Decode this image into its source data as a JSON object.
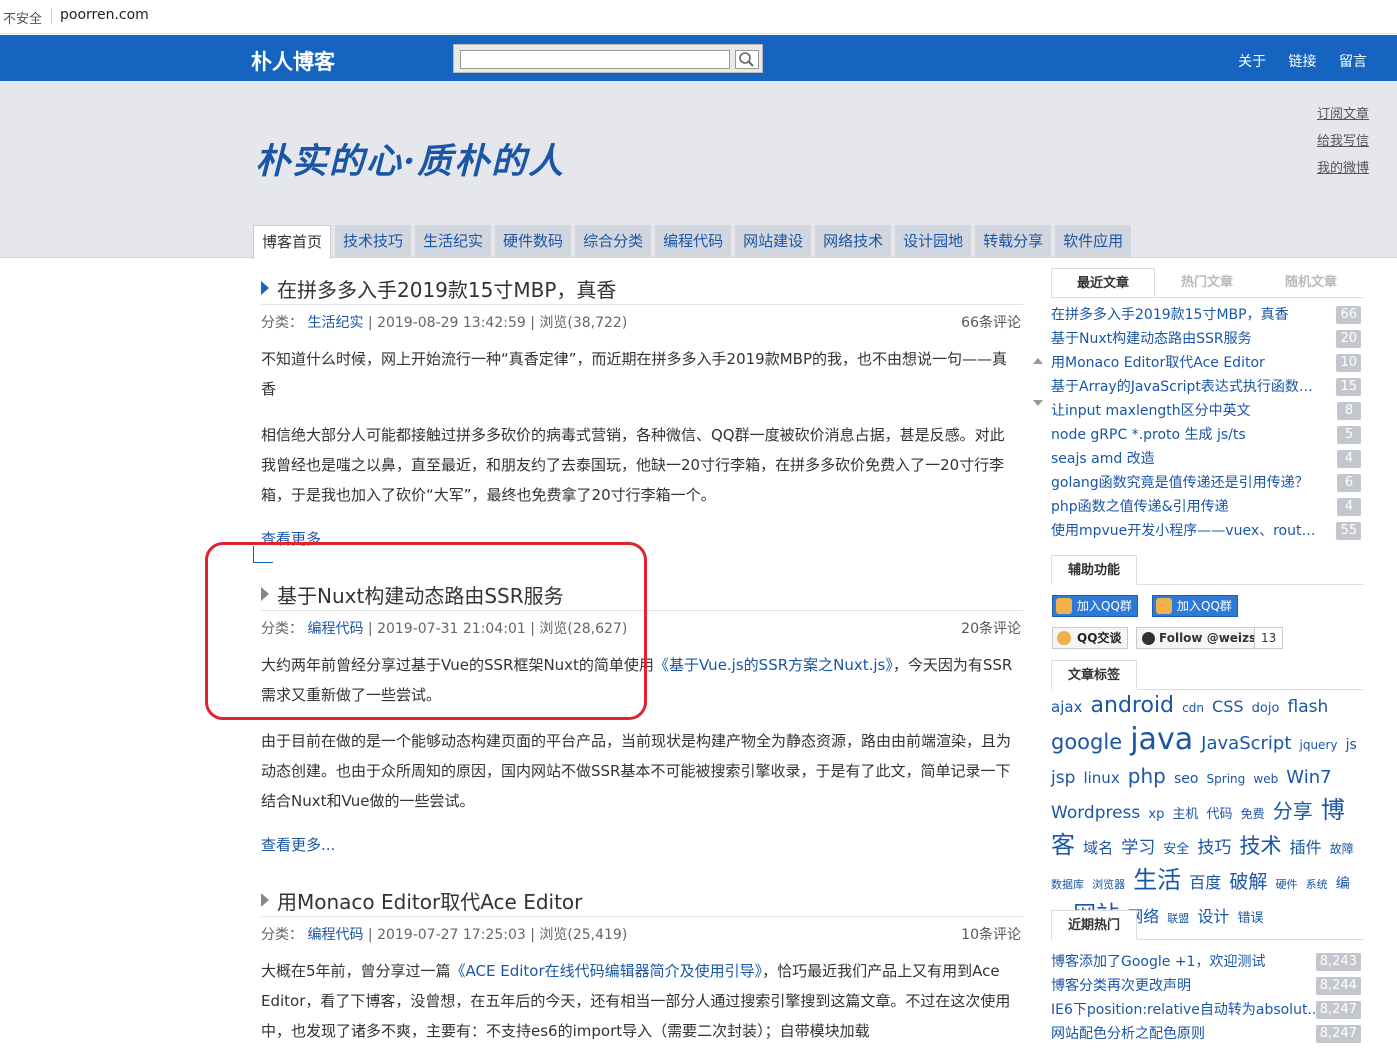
{
  "browser": {
    "insecure": "不安全",
    "url": "poorren.com"
  },
  "header": {
    "brand": "朴人博客",
    "search_placeholder": "",
    "nav": [
      "关于",
      "链接",
      "留言"
    ]
  },
  "banner": {
    "slogan": "朴实的心·质朴的人",
    "side_links": [
      "订阅文章",
      "给我写信",
      "我的微博"
    ],
    "categories": [
      "博客首页",
      "技术技巧",
      "生活纪实",
      "硬件数码",
      "综合分类",
      "编程代码",
      "网站建设",
      "网络技术",
      "设计园地",
      "转载分享",
      "软件应用"
    ]
  },
  "posts": [
    {
      "title": "在拼多多入手2019款15寸MBP，真香",
      "meta_prefix": "分类：",
      "category": "生活纪实",
      "meta_suffix": "| 2019-08-29 13:42:59 | 浏览(38,722)",
      "comments": "66条评论",
      "p1": "不知道什么时候，网上开始流行一种“真香定律”，而近期在拼多多入手2019款MBP的我，也不由想说一句——真香",
      "p2": "相信绝大部分人可能都接触过拼多多砍价的病毒式营销，各种微信、QQ群一度被砍价消息占据，甚是反感。对此我曾经也是嗤之以鼻，直至最近，和朋友约了去泰国玩，他缺一20寸行李箱，在拼多多砍价免费入了一20寸行李箱，于是我也加入了砍价“大军”，最终也免费拿了20寸行李箱一个。",
      "more": "查看更多..."
    },
    {
      "title": "基于Nuxt构建动态路由SSR服务",
      "meta_prefix": "分类：",
      "category": "编程代码",
      "meta_suffix": "| 2019-07-31 21:04:01 | 浏览(28,627)",
      "comments": "20条评论",
      "p1_a": "大约两年前曾经分享过基于Vue的SSR框架Nuxt的简单使用",
      "p1_link": "《基于Vue.js的SSR方案之Nuxt.js》",
      "p1_b": "，今天因为有SSR需求又重新做了一些尝试。",
      "p2": "由于目前在做的是一个能够动态构建页面的平台产品，当前现状是构建产物全为静态资源，路由由前端渲染，且为动态创建。也由于众所周知的原因，国内网站不做SSR基本不可能被搜索引擎收录，于是有了此文，简单记录一下结合Nuxt和Vue做的一些尝试。",
      "more": "查看更多..."
    },
    {
      "title": "用Monaco Editor取代Ace Editor",
      "meta_prefix": "分类：",
      "category": "编程代码",
      "meta_suffix": "| 2019-07-27 17:25:03 | 浏览(25,419)",
      "comments": "10条评论",
      "p1_a": "大概在5年前，曾分享过一篇",
      "p1_link": "《ACE Editor在线代码编辑器简介及使用引导》",
      "p1_b": "，恰巧最近我们产品上又有用到Ace Editor，看了下博客，没曾想，在五年后的今天，还有相当一部分人通过搜索引擎搜到这篇文章。不过在这次使用中，也发现了诸多不爽，主要有：不支持es6的import导入（需要二次封装）；自带模块加载"
    }
  ],
  "sidebar": {
    "tabs": [
      "最近文章",
      "热门文章",
      "随机文章"
    ],
    "recent": [
      {
        "title": "在拼多多入手2019款15寸MBP，真香",
        "count": "66"
      },
      {
        "title": "基于Nuxt构建动态路由SSR服务",
        "count": "20"
      },
      {
        "title": "用Monaco Editor取代Ace Editor",
        "count": "10"
      },
      {
        "title": "基于Array的JavaScript表达式执行函数实现",
        "count": "15"
      },
      {
        "title": "让input maxlength区分中英文",
        "count": "8"
      },
      {
        "title": "node gRPC *.proto 生成 js/ts",
        "count": "5"
      },
      {
        "title": "seajs amd 改造",
        "count": "4"
      },
      {
        "title": "golang函数究竟是值传递还是引用传递？",
        "count": "6"
      },
      {
        "title": "php函数之值传递&引用传递",
        "count": "4"
      },
      {
        "title": "使用mpvue开发小程序——vuex、router...",
        "count": "55"
      }
    ],
    "aux_title": "辅助功能",
    "qq_group_1": "加入QQ群",
    "qq_group_2": "加入QQ群",
    "qq_talk": "QQ交谈",
    "github_follow": "Follow @weizs",
    "github_count": "13",
    "tags_title": "文章标签",
    "tags": [
      {
        "t": "ajax",
        "s": 15
      },
      {
        "t": "android",
        "s": 22
      },
      {
        "t": "cdn",
        "s": 12
      },
      {
        "t": "CSS",
        "s": 16
      },
      {
        "t": "dojo",
        "s": 13
      },
      {
        "t": "flash",
        "s": 17
      },
      {
        "t": "google",
        "s": 21
      },
      {
        "t": "java",
        "s": 30
      },
      {
        "t": "JavaScript",
        "s": 18
      },
      {
        "t": "jquery",
        "s": 12
      },
      {
        "t": "js",
        "s": 14
      },
      {
        "t": "jsp",
        "s": 17
      },
      {
        "t": "linux",
        "s": 15
      },
      {
        "t": "php",
        "s": 20
      },
      {
        "t": "seo",
        "s": 14
      },
      {
        "t": "Spring",
        "s": 12
      },
      {
        "t": "web",
        "s": 12
      },
      {
        "t": "Win7",
        "s": 18
      },
      {
        "t": "Wordpress",
        "s": 17
      },
      {
        "t": "xp",
        "s": 13
      },
      {
        "t": "主机",
        "s": 13
      },
      {
        "t": "代码",
        "s": 13
      },
      {
        "t": "免费",
        "s": 12
      },
      {
        "t": "分享",
        "s": 20
      },
      {
        "t": "博客",
        "s": 24
      },
      {
        "t": "域名",
        "s": 15
      },
      {
        "t": "学习",
        "s": 17
      },
      {
        "t": "安全",
        "s": 13
      },
      {
        "t": "技巧",
        "s": 17
      },
      {
        "t": "技术",
        "s": 21
      },
      {
        "t": "插件",
        "s": 16
      },
      {
        "t": "故障",
        "s": 12
      },
      {
        "t": "数据库",
        "s": 11
      },
      {
        "t": "浏览器",
        "s": 11
      },
      {
        "t": "生活",
        "s": 24
      },
      {
        "t": "百度",
        "s": 16
      },
      {
        "t": "破解",
        "s": 19
      },
      {
        "t": "硬件",
        "s": 11
      },
      {
        "t": "系统",
        "s": 11
      },
      {
        "t": "编程",
        "s": 14
      },
      {
        "t": "网站",
        "s": 23
      },
      {
        "t": "网络",
        "s": 16
      },
      {
        "t": "联盟",
        "s": 11
      },
      {
        "t": "设计",
        "s": 16
      },
      {
        "t": "错误",
        "s": 13
      }
    ],
    "hot_title": "近期热门",
    "hot": [
      {
        "title": "博客添加了Google +1，欢迎测试",
        "count": "8,243"
      },
      {
        "title": "博客分类再次更改声明",
        "count": "8,244"
      },
      {
        "title": "IE6下position:relative自动转为absolut...",
        "count": "8,247"
      },
      {
        "title": "网站配色分析之配色原则",
        "count": "8,247"
      }
    ]
  },
  "colors": {
    "header_blue": "#1565c0",
    "link": "#1a56a6",
    "banner_bg": "#e6e7ec",
    "highlight_red": "#e0232f"
  }
}
